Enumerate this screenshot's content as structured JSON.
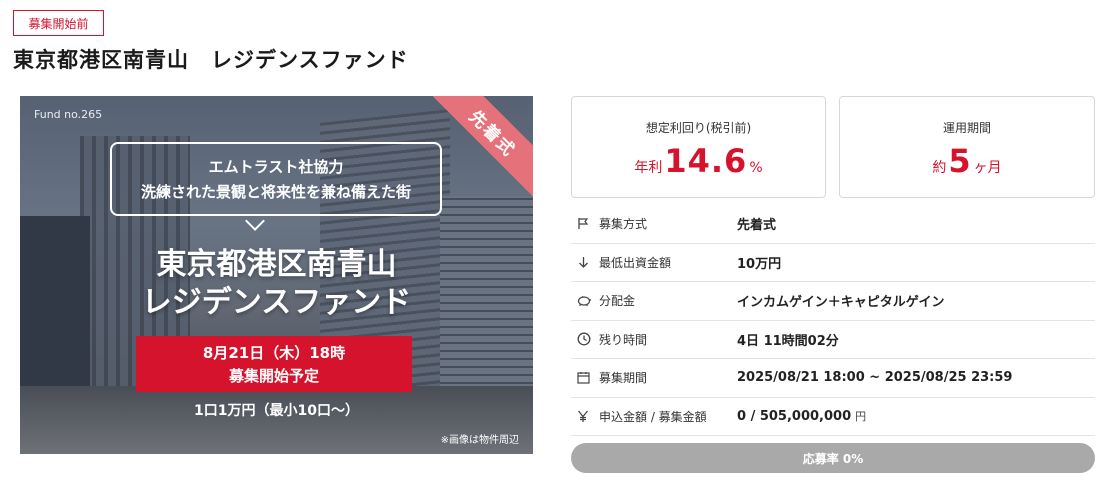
{
  "status_tag": "募集開始前",
  "title": "東京都港区南青山　レジデンスファンド",
  "hero": {
    "fund_no": "Fund no.265",
    "ribbon": "先着式",
    "bubble_line1": "エムトラスト社協力",
    "bubble_line2": "洗練された景観と将来性を兼ね備えた街",
    "title_line1": "東京都港区南青山",
    "title_line2": "レジデンスファンド",
    "date_line1": "8月21日（木）18時",
    "date_line2": "募集開始予定",
    "unit_text": "1口1万円（最小10口〜）",
    "note": "※画像は物件周辺"
  },
  "cards": {
    "yield_label": "想定利回り(税引前)",
    "yield_prefix": "年利",
    "yield_value": "14.6",
    "yield_suffix": "%",
    "period_label": "運用期間",
    "period_prefix": "約",
    "period_value": "5",
    "period_suffix": "ヶ月"
  },
  "rows": [
    {
      "icon": "flag-icon",
      "label": "募集方式",
      "value": "先着式"
    },
    {
      "icon": "arrow-down-icon",
      "label": "最低出資金額",
      "value": "10万円"
    },
    {
      "icon": "piggy-bank-icon",
      "label": "分配金",
      "value": "インカムゲイン＋キャピタルゲイン"
    },
    {
      "icon": "clock-icon",
      "label": "残り時間",
      "value": "4日 11時間02分"
    },
    {
      "icon": "calendar-icon",
      "label": "募集期間",
      "value": "2025/08/21 18:00 ~ 2025/08/25 23:59"
    },
    {
      "icon": "yen-icon",
      "label": "申込金額 / 募集金額",
      "value": "0 / 505,000,000",
      "unit": "円"
    }
  ],
  "progress": {
    "label": "応募率 0%",
    "rate": 0
  },
  "colors": {
    "accent": "#d6132c",
    "progress_bg": "#a9a9a9",
    "ribbon": "#e5727a"
  }
}
